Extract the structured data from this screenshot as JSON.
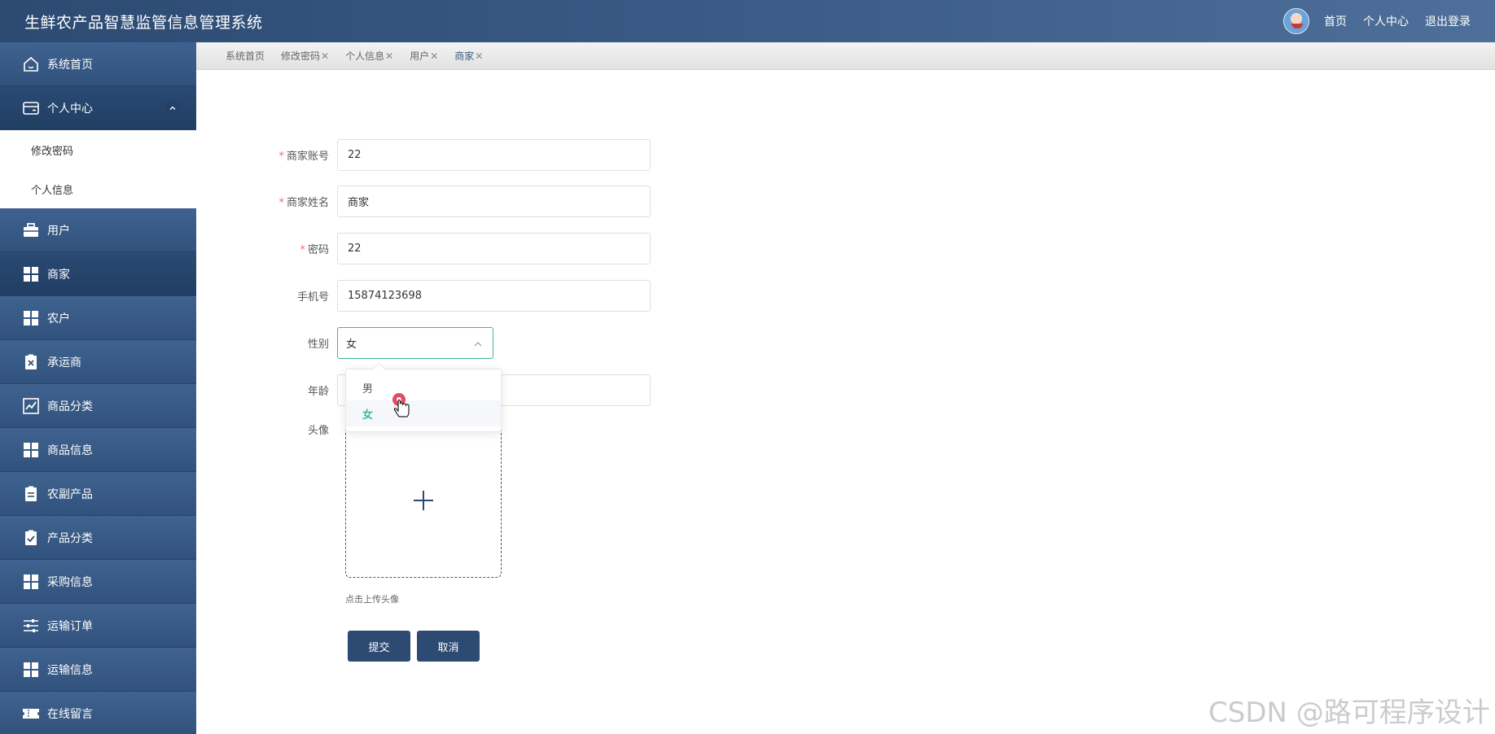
{
  "header": {
    "title": "生鲜农产品智慧监管信息管理系统",
    "links": [
      "首页",
      "个人中心",
      "退出登录"
    ]
  },
  "sidebar": {
    "items": [
      {
        "label": "系统首页",
        "icon": "home-icon"
      },
      {
        "label": "个人中心",
        "icon": "wallet-icon",
        "expanded": true,
        "children": [
          "修改密码",
          "个人信息"
        ]
      },
      {
        "label": "用户",
        "icon": "briefcase-icon"
      },
      {
        "label": "商家",
        "icon": "grid-icon",
        "active": true
      },
      {
        "label": "农户",
        "icon": "grid-icon"
      },
      {
        "label": "承运商",
        "icon": "clipboard-x-icon"
      },
      {
        "label": "商品分类",
        "icon": "chart-icon"
      },
      {
        "label": "商品信息",
        "icon": "grid-icon"
      },
      {
        "label": "农副产品",
        "icon": "clipboard-icon"
      },
      {
        "label": "产品分类",
        "icon": "clipboard-check-icon"
      },
      {
        "label": "采购信息",
        "icon": "grid-icon"
      },
      {
        "label": "运输订单",
        "icon": "sliders-icon"
      },
      {
        "label": "运输信息",
        "icon": "grid-icon"
      },
      {
        "label": "在线留言",
        "icon": "ticket-icon"
      }
    ]
  },
  "tags": [
    {
      "label": "系统首页",
      "closable": false
    },
    {
      "label": "修改密码",
      "closable": true
    },
    {
      "label": "个人信息",
      "closable": true
    },
    {
      "label": "用户",
      "closable": true
    },
    {
      "label": "商家",
      "closable": true,
      "current": true
    }
  ],
  "form": {
    "account": {
      "label": "商家账号",
      "value": "22",
      "required": true
    },
    "name": {
      "label": "商家姓名",
      "value": "商家",
      "required": true
    },
    "password": {
      "label": "密码",
      "value": "22",
      "required": true
    },
    "phone": {
      "label": "手机号",
      "value": "15874123698"
    },
    "gender": {
      "label": "性别",
      "value": "女",
      "options": [
        "男",
        "女"
      ]
    },
    "age": {
      "label": "年龄",
      "value": ""
    },
    "avatar": {
      "label": "头像",
      "tip": "点击上传头像"
    },
    "submit": "提交",
    "cancel": "取消"
  },
  "close_glyph": "✕",
  "watermark": "CSDN @路可程序设计",
  "colors": {
    "primary": "#2c4a72",
    "accent": "#3fb69a",
    "required": "#f56c6c"
  }
}
